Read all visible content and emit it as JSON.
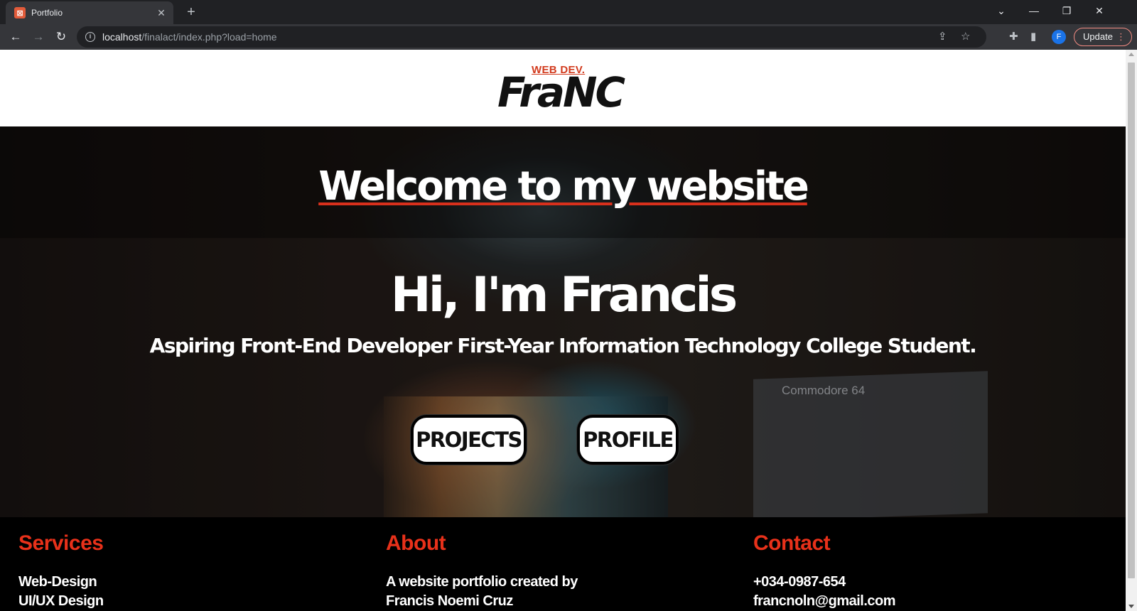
{
  "browser": {
    "tab_title": "Portfolio",
    "tab_favicon": "xampp-icon",
    "url_host": "localhost",
    "url_path": "/finalact/index.php?load=home",
    "profile_initial": "F",
    "update_label": "Update"
  },
  "site": {
    "logo_small": "WEB DEV.",
    "logo_big": "FraNC",
    "welcome": "Welcome to my website",
    "greeting": "Hi, I'm Francis",
    "tagline": "Aspiring Front-End Developer First-Year Information Technology College Student.",
    "buttons": {
      "projects": "PROJECTS",
      "profile": "PROFILE"
    },
    "background_book_title": "Commodore 64"
  },
  "footer": {
    "services": {
      "heading": "Services",
      "lines": [
        "Web-Design",
        "UI/UX Design"
      ]
    },
    "about": {
      "heading": "About",
      "lines": [
        "A website portfolio created by",
        "Francis Noemi Cruz"
      ]
    },
    "contact": {
      "heading": "Contact",
      "lines": [
        "+034-0987-654",
        "francnoln@gmail.com"
      ]
    }
  },
  "colors": {
    "accent_red": "#e8311a",
    "chrome_dark": "#202124",
    "chrome_toolbar": "#35363a"
  }
}
